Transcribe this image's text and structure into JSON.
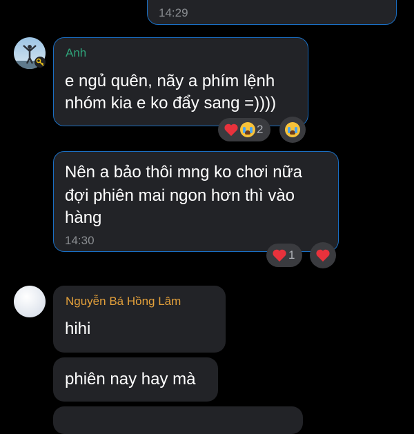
{
  "colors": {
    "background": "#000000",
    "bubble": "#222327",
    "bubble_border": "#1a6fc4",
    "sender_anh": "#2fa37a",
    "sender_lam": "#e3a03b",
    "time": "#8a8d91",
    "heart": "#e8323c"
  },
  "messages": {
    "top_time": "14:29",
    "anh": {
      "sender": "Anh",
      "line1": "e ngủ quên, nãy a phím lệnh",
      "line2": "nhóm kia e ko đẩy sang =))))",
      "reaction_count": "2"
    },
    "reply": {
      "line1": "Nên a bảo thôi mng ko chơi nữa",
      "line2": "đợi phiên mai ngon hơn thì vào",
      "line3": "hàng",
      "time": "14:30",
      "reaction_count": "1"
    },
    "lam": {
      "sender": "Nguyễn Bá Hồng Lâm",
      "msg1": "hihi",
      "msg2": "phiên nay hay mà"
    }
  },
  "icons": {
    "heart": "heart-icon",
    "cry": "crying-face-icon",
    "key": "key-badge-icon"
  }
}
